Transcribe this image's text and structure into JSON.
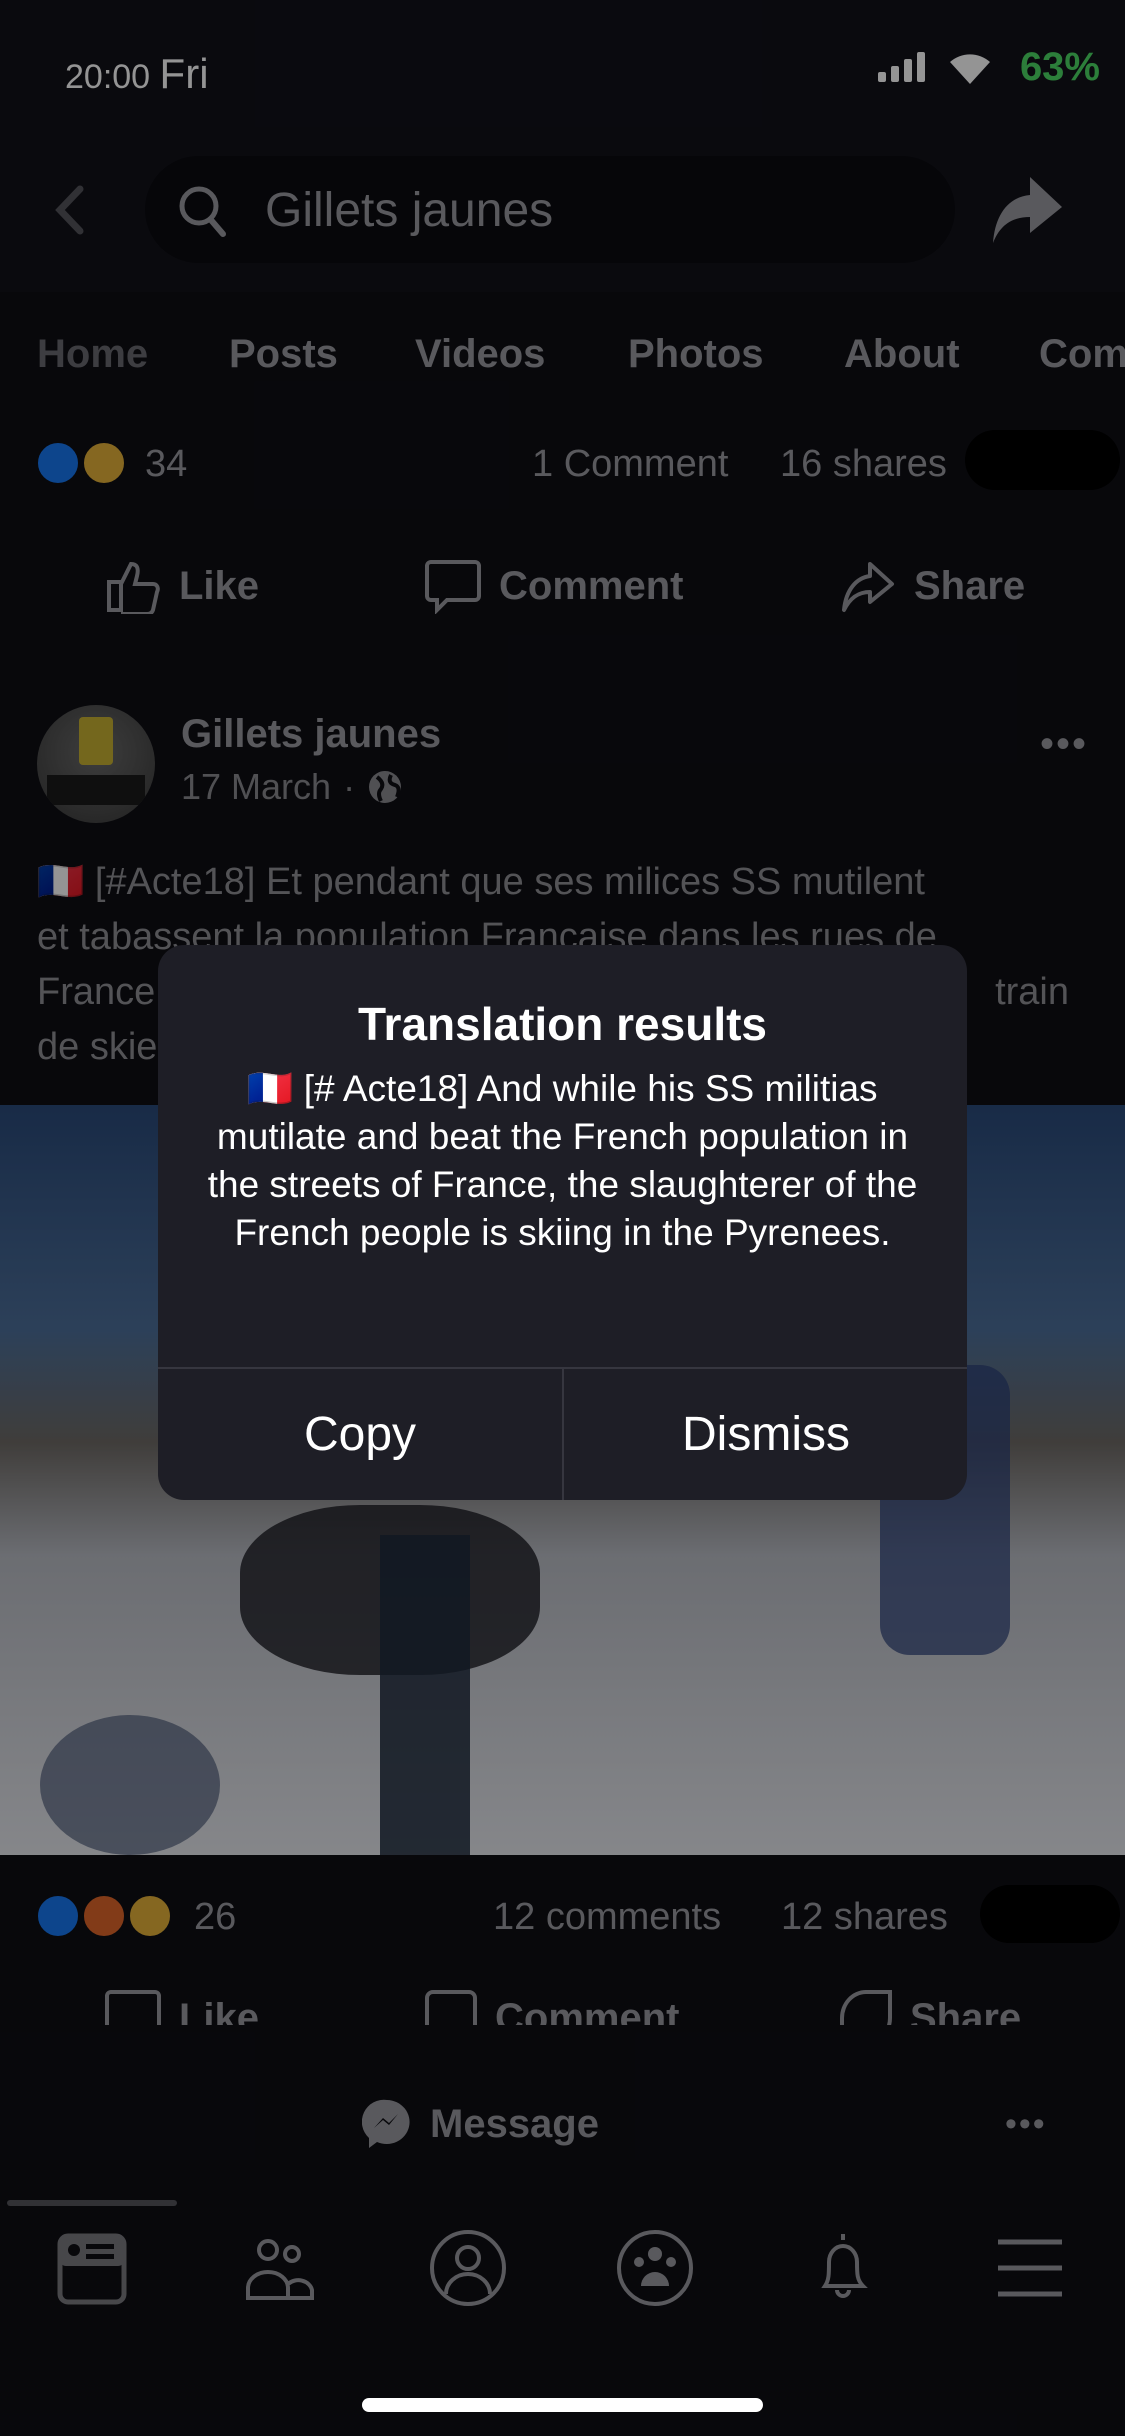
{
  "status_bar": {
    "time": "20:00",
    "day": "Fri",
    "battery": "63%"
  },
  "search": {
    "value": "Gillets jaunes"
  },
  "tabs": [
    "Home",
    "Posts",
    "Videos",
    "Photos",
    "About",
    "Com"
  ],
  "prev_post": {
    "reaction_count": "34",
    "comments": "1 Comment",
    "shares": "16 shares"
  },
  "actions": {
    "like": "Like",
    "comment": "Comment",
    "share": "Share"
  },
  "post": {
    "author": "Gillets jaunes",
    "date": "17 March",
    "separator": "·",
    "text_lines": [
      "🇫🇷 [#Acte18] Et pendant que ses milices SS mutilent",
      "et tabassent la population Francaise dans les rues de",
      "France",
      "de skie"
    ],
    "text_line3_end": "train",
    "reaction_count": "26",
    "comments": "12 comments",
    "shares": "12 shares"
  },
  "dialog": {
    "title": "Translation results",
    "body": "🇫🇷 [# Acte18] And while his SS militias mutilate and beat the French population in the streets of France, the slaughterer of the French people is skiing in the Pyrenees.",
    "copy": "Copy",
    "dismiss": "Dismiss"
  },
  "message_bar": {
    "label": "Message"
  },
  "bottom_nav": [
    "news-feed-icon",
    "friends-icon",
    "profile-icon",
    "groups-icon",
    "notifications-bell-icon",
    "menu-icon"
  ],
  "colors": {
    "accent_battery": "#4cd964",
    "like_blue": "#1877f2"
  }
}
